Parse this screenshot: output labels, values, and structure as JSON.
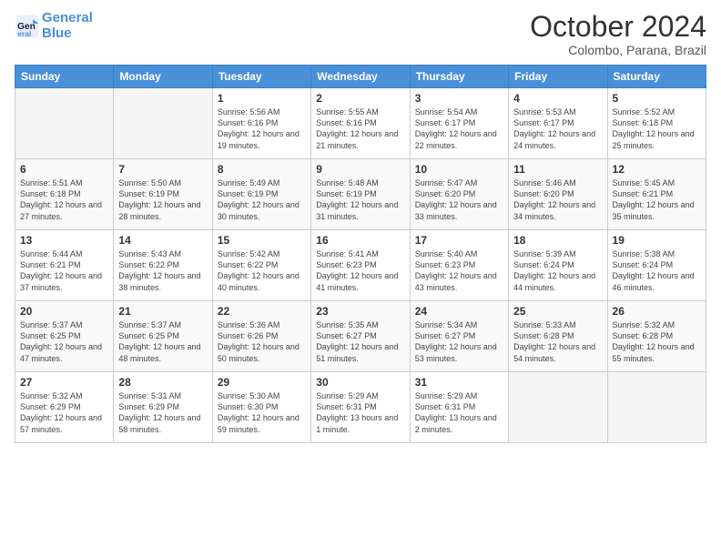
{
  "logo": {
    "line1": "General",
    "line2": "Blue"
  },
  "title": "October 2024",
  "subtitle": "Colombo, Parana, Brazil",
  "weekdays": [
    "Sunday",
    "Monday",
    "Tuesday",
    "Wednesday",
    "Thursday",
    "Friday",
    "Saturday"
  ],
  "weeks": [
    [
      {
        "day": "",
        "info": ""
      },
      {
        "day": "",
        "info": ""
      },
      {
        "day": "1",
        "info": "Sunrise: 5:56 AM\nSunset: 6:16 PM\nDaylight: 12 hours and 19 minutes."
      },
      {
        "day": "2",
        "info": "Sunrise: 5:55 AM\nSunset: 6:16 PM\nDaylight: 12 hours and 21 minutes."
      },
      {
        "day": "3",
        "info": "Sunrise: 5:54 AM\nSunset: 6:17 PM\nDaylight: 12 hours and 22 minutes."
      },
      {
        "day": "4",
        "info": "Sunrise: 5:53 AM\nSunset: 6:17 PM\nDaylight: 12 hours and 24 minutes."
      },
      {
        "day": "5",
        "info": "Sunrise: 5:52 AM\nSunset: 6:18 PM\nDaylight: 12 hours and 25 minutes."
      }
    ],
    [
      {
        "day": "6",
        "info": "Sunrise: 5:51 AM\nSunset: 6:18 PM\nDaylight: 12 hours and 27 minutes."
      },
      {
        "day": "7",
        "info": "Sunrise: 5:50 AM\nSunset: 6:19 PM\nDaylight: 12 hours and 28 minutes."
      },
      {
        "day": "8",
        "info": "Sunrise: 5:49 AM\nSunset: 6:19 PM\nDaylight: 12 hours and 30 minutes."
      },
      {
        "day": "9",
        "info": "Sunrise: 5:48 AM\nSunset: 6:19 PM\nDaylight: 12 hours and 31 minutes."
      },
      {
        "day": "10",
        "info": "Sunrise: 5:47 AM\nSunset: 6:20 PM\nDaylight: 12 hours and 33 minutes."
      },
      {
        "day": "11",
        "info": "Sunrise: 5:46 AM\nSunset: 6:20 PM\nDaylight: 12 hours and 34 minutes."
      },
      {
        "day": "12",
        "info": "Sunrise: 5:45 AM\nSunset: 6:21 PM\nDaylight: 12 hours and 35 minutes."
      }
    ],
    [
      {
        "day": "13",
        "info": "Sunrise: 5:44 AM\nSunset: 6:21 PM\nDaylight: 12 hours and 37 minutes."
      },
      {
        "day": "14",
        "info": "Sunrise: 5:43 AM\nSunset: 6:22 PM\nDaylight: 12 hours and 38 minutes."
      },
      {
        "day": "15",
        "info": "Sunrise: 5:42 AM\nSunset: 6:22 PM\nDaylight: 12 hours and 40 minutes."
      },
      {
        "day": "16",
        "info": "Sunrise: 5:41 AM\nSunset: 6:23 PM\nDaylight: 12 hours and 41 minutes."
      },
      {
        "day": "17",
        "info": "Sunrise: 5:40 AM\nSunset: 6:23 PM\nDaylight: 12 hours and 43 minutes."
      },
      {
        "day": "18",
        "info": "Sunrise: 5:39 AM\nSunset: 6:24 PM\nDaylight: 12 hours and 44 minutes."
      },
      {
        "day": "19",
        "info": "Sunrise: 5:38 AM\nSunset: 6:24 PM\nDaylight: 12 hours and 46 minutes."
      }
    ],
    [
      {
        "day": "20",
        "info": "Sunrise: 5:37 AM\nSunset: 6:25 PM\nDaylight: 12 hours and 47 minutes."
      },
      {
        "day": "21",
        "info": "Sunrise: 5:37 AM\nSunset: 6:25 PM\nDaylight: 12 hours and 48 minutes."
      },
      {
        "day": "22",
        "info": "Sunrise: 5:36 AM\nSunset: 6:26 PM\nDaylight: 12 hours and 50 minutes."
      },
      {
        "day": "23",
        "info": "Sunrise: 5:35 AM\nSunset: 6:27 PM\nDaylight: 12 hours and 51 minutes."
      },
      {
        "day": "24",
        "info": "Sunrise: 5:34 AM\nSunset: 6:27 PM\nDaylight: 12 hours and 53 minutes."
      },
      {
        "day": "25",
        "info": "Sunrise: 5:33 AM\nSunset: 6:28 PM\nDaylight: 12 hours and 54 minutes."
      },
      {
        "day": "26",
        "info": "Sunrise: 5:32 AM\nSunset: 6:28 PM\nDaylight: 12 hours and 55 minutes."
      }
    ],
    [
      {
        "day": "27",
        "info": "Sunrise: 5:32 AM\nSunset: 6:29 PM\nDaylight: 12 hours and 57 minutes."
      },
      {
        "day": "28",
        "info": "Sunrise: 5:31 AM\nSunset: 6:29 PM\nDaylight: 12 hours and 58 minutes."
      },
      {
        "day": "29",
        "info": "Sunrise: 5:30 AM\nSunset: 6:30 PM\nDaylight: 12 hours and 59 minutes."
      },
      {
        "day": "30",
        "info": "Sunrise: 5:29 AM\nSunset: 6:31 PM\nDaylight: 13 hours and 1 minute."
      },
      {
        "day": "31",
        "info": "Sunrise: 5:29 AM\nSunset: 6:31 PM\nDaylight: 13 hours and 2 minutes."
      },
      {
        "day": "",
        "info": ""
      },
      {
        "day": "",
        "info": ""
      }
    ]
  ]
}
